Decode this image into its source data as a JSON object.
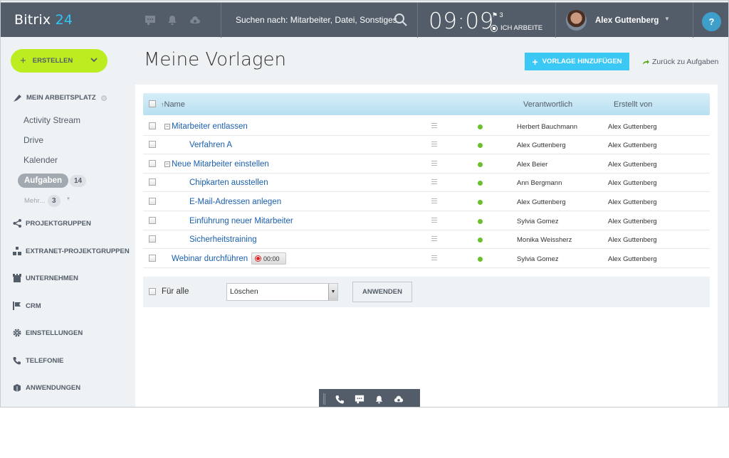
{
  "header": {
    "logo_text": "Bitrix",
    "logo_num": "24",
    "icons": [
      "chat-icon",
      "bell-icon",
      "cloud-icon"
    ],
    "search_placeholder": "Suchen nach: Mitarbeiter, Datei, Sonstiges",
    "time": "09:09",
    "flag_count": "3",
    "work_status": "ICH ARBEITE",
    "user_name": "Alex Guttenberg",
    "help_label": "?"
  },
  "sidebar": {
    "create_label": "ERSTELLEN",
    "workspace_title": "MEIN ARBEITSPLATZ",
    "links": [
      "Activity Stream",
      "Drive",
      "Kalender"
    ],
    "active_item": "Aufgaben",
    "active_count": "14",
    "more_label": "Mehr...",
    "more_count": "3",
    "sections": [
      "PROJEKTGRUPPEN",
      "EXTRANET-PROJEKTGRUPPEN",
      "UNTERNEHMEN",
      "CRM",
      "EINSTELLUNGEN",
      "TELEFONIE",
      "ANWENDUNGEN"
    ]
  },
  "main": {
    "title": "Meine Vorlagen",
    "add_button": "VORLAGE HINZUFÜGEN",
    "back_link": "Zurück zu Aufgaben",
    "columns": {
      "name": "Name",
      "sort_indicator": "↑",
      "responsible": "Verantwortlich",
      "created_by": "Erstellt von"
    },
    "rows": [
      {
        "name": "Mitarbeiter entlassen",
        "level": 0,
        "expandable": true,
        "responsible": "Herbert Bauchmann",
        "created_by": "Alex Guttenberg"
      },
      {
        "name": "Verfahren A",
        "level": 1,
        "expandable": false,
        "responsible": "Alex Guttenberg",
        "created_by": "Alex Guttenberg"
      },
      {
        "name": "Neue Mitarbeiter einstellen",
        "level": 0,
        "expandable": true,
        "responsible": "Alex Beier",
        "created_by": "Alex Guttenberg"
      },
      {
        "name": "Chipkarten ausstellen",
        "level": 1,
        "expandable": false,
        "responsible": "Ann Bergmann",
        "created_by": "Alex Guttenberg"
      },
      {
        "name": "E-Mail-Adressen anlegen",
        "level": 1,
        "expandable": false,
        "responsible": "Alex Guttenberg",
        "created_by": "Alex Guttenberg"
      },
      {
        "name": "Einführung neuer Mitarbeiter",
        "level": 1,
        "expandable": false,
        "responsible": "Sylvia Gomez",
        "created_by": "Alex Guttenberg"
      },
      {
        "name": "Sicherheitstraining",
        "level": 1,
        "expandable": false,
        "responsible": "Monika Weissherz",
        "created_by": "Alex Guttenberg"
      },
      {
        "name": "Webinar durchführen",
        "level": 0,
        "expandable": false,
        "responsible": "Sylvia Gomez",
        "created_by": "Alex Guttenberg",
        "timer": "00:00"
      }
    ],
    "footer": {
      "for_all_label": "Für alle",
      "action_selected": "Löschen",
      "apply_label": "ANWENDEN"
    }
  },
  "bottom_bar": {
    "icons": [
      "phone-icon",
      "chat-icon",
      "bell-icon",
      "cloud-icon"
    ]
  },
  "colors": {
    "header_bg": "#535c69",
    "accent_blue": "#3bc8f5",
    "create_green": "#bbed21",
    "status_green": "#6bbf2d",
    "link_blue": "#1b5fad"
  }
}
